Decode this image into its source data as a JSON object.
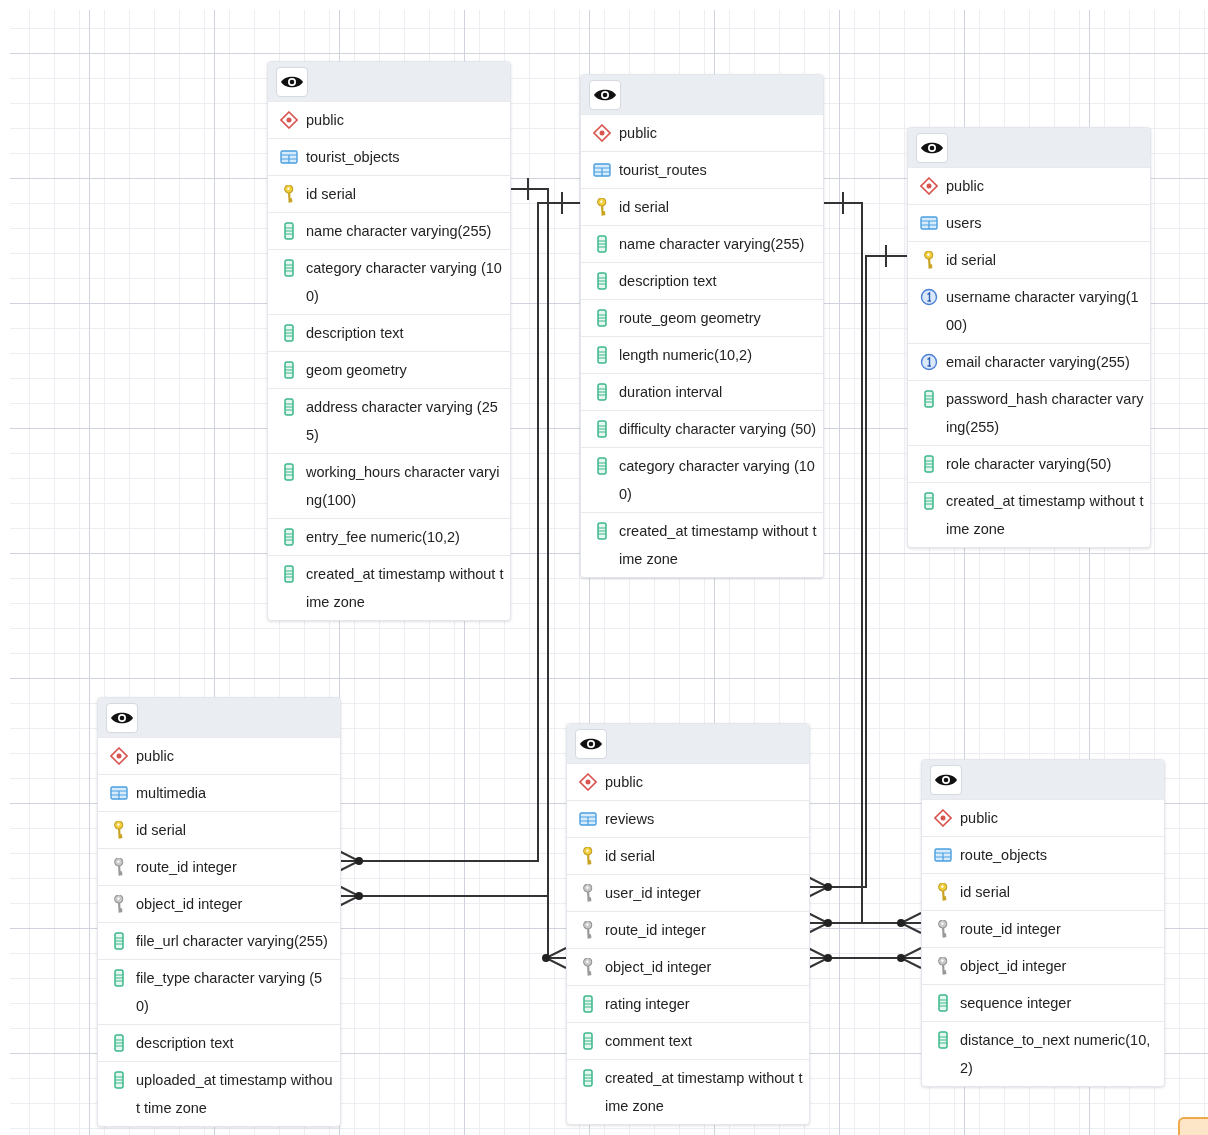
{
  "tables": [
    {
      "rows": [
        {
          "kind": "schema",
          "text": "public"
        },
        {
          "kind": "table",
          "text": "tourist_objects"
        },
        {
          "kind": "pk",
          "text": "id serial"
        },
        {
          "kind": "column",
          "text": "name character varying(255)"
        },
        {
          "kind": "column",
          "text": "category character varying (100)"
        },
        {
          "kind": "column",
          "text": "description text"
        },
        {
          "kind": "column",
          "text": "geom geometry"
        },
        {
          "kind": "column",
          "text": "address character varying (255)"
        },
        {
          "kind": "column",
          "text": "working_hours character varying(100)"
        },
        {
          "kind": "column",
          "text": "entry_fee numeric(10,2)"
        },
        {
          "kind": "column",
          "text": "created_at timestamp without time zone"
        }
      ]
    },
    {
      "rows": [
        {
          "kind": "schema",
          "text": "public"
        },
        {
          "kind": "table",
          "text": "tourist_routes"
        },
        {
          "kind": "pk",
          "text": "id serial"
        },
        {
          "kind": "column",
          "text": "name character varying(255)"
        },
        {
          "kind": "column",
          "text": "description text"
        },
        {
          "kind": "column",
          "text": "route_geom geometry"
        },
        {
          "kind": "column",
          "text": "length numeric(10,2)"
        },
        {
          "kind": "column",
          "text": "duration interval"
        },
        {
          "kind": "column",
          "text": "difficulty character varying (50)"
        },
        {
          "kind": "column",
          "text": "category character varying (100)"
        },
        {
          "kind": "column",
          "text": "created_at timestamp without time zone"
        }
      ]
    },
    {
      "rows": [
        {
          "kind": "schema",
          "text": "public"
        },
        {
          "kind": "table",
          "text": "users"
        },
        {
          "kind": "pk",
          "text": "id serial"
        },
        {
          "kind": "unique",
          "text": "username character varying(100)"
        },
        {
          "kind": "unique",
          "text": "email character varying(255)"
        },
        {
          "kind": "column",
          "text": "password_hash character varying(255)"
        },
        {
          "kind": "column",
          "text": "role character varying(50)"
        },
        {
          "kind": "column",
          "text": "created_at timestamp without time zone"
        }
      ]
    },
    {
      "rows": [
        {
          "kind": "schema",
          "text": "public"
        },
        {
          "kind": "table",
          "text": "multimedia"
        },
        {
          "kind": "pk",
          "text": "id serial"
        },
        {
          "kind": "fk",
          "text": "route_id integer"
        },
        {
          "kind": "fk",
          "text": "object_id integer"
        },
        {
          "kind": "column",
          "text": "file_url character varying(255)"
        },
        {
          "kind": "column",
          "text": "file_type character varying (50)"
        },
        {
          "kind": "column",
          "text": "description text"
        },
        {
          "kind": "column",
          "text": "uploaded_at timestamp without time zone"
        }
      ]
    },
    {
      "rows": [
        {
          "kind": "schema",
          "text": "public"
        },
        {
          "kind": "table",
          "text": "reviews"
        },
        {
          "kind": "pk",
          "text": "id serial"
        },
        {
          "kind": "fk",
          "text": "user_id integer"
        },
        {
          "kind": "fk",
          "text": "route_id integer"
        },
        {
          "kind": "fk",
          "text": "object_id integer"
        },
        {
          "kind": "column",
          "text": "rating integer"
        },
        {
          "kind": "column",
          "text": "comment text"
        },
        {
          "kind": "column",
          "text": "created_at timestamp without time zone"
        }
      ]
    },
    {
      "rows": [
        {
          "kind": "schema",
          "text": "public"
        },
        {
          "kind": "table",
          "text": "route_objects"
        },
        {
          "kind": "pk",
          "text": "id serial"
        },
        {
          "kind": "fk",
          "text": "route_id integer"
        },
        {
          "kind": "fk",
          "text": "object_id integer"
        },
        {
          "kind": "column",
          "text": "sequence integer"
        },
        {
          "kind": "column",
          "text": "distance_to_next numeric(10,2)"
        }
      ]
    }
  ]
}
